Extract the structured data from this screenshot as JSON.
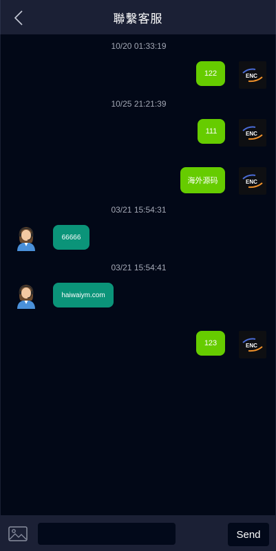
{
  "header": {
    "title": "聯繫客服",
    "back_icon": "chevron-left-icon"
  },
  "messages": [
    {
      "time": "10/20 01:33:19",
      "side": "out",
      "text": "122"
    },
    {
      "time": "10/25 21:21:39",
      "side": "out",
      "text": "111"
    },
    {
      "side": "out",
      "text": "海外源码"
    },
    {
      "time": "03/21 15:54:31",
      "side": "in",
      "text": "66666"
    },
    {
      "time": "03/21 15:54:41",
      "side": "in",
      "text": "haiwaiym.com"
    },
    {
      "side": "out",
      "text": "123"
    }
  ],
  "footer": {
    "image_icon": "image-icon",
    "input_value": "",
    "input_placeholder": "",
    "send_label": "Send"
  },
  "colors": {
    "background": "#020817",
    "header": "#1b2035",
    "outgoing_bubble": "#66cc00",
    "incoming_bubble": "#0b9479"
  }
}
